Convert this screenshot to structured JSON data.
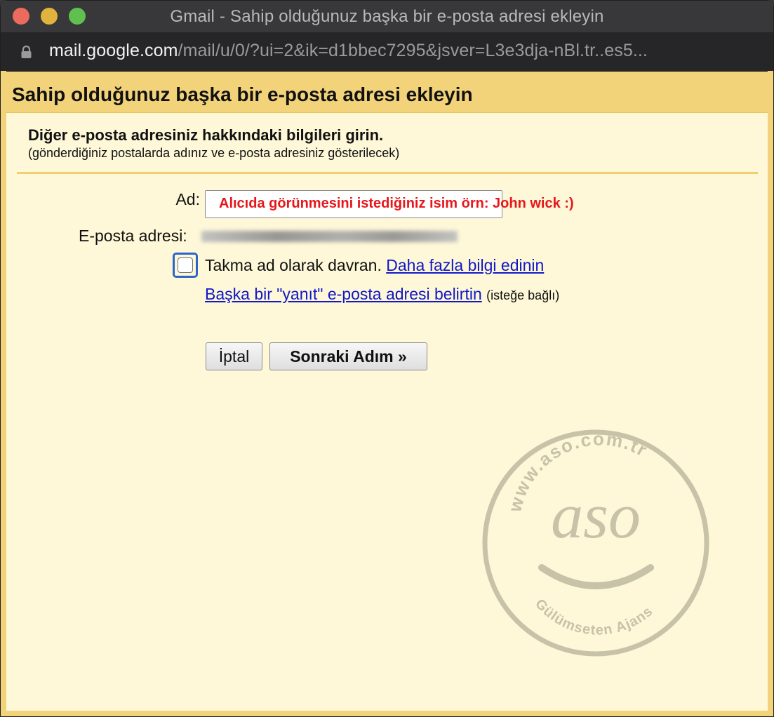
{
  "window": {
    "title": "Gmail - Sahip olduğunuz başka bir e-posta adresi ekleyin",
    "url_host": "mail.google.com",
    "url_path": "/mail/u/0/?ui=2&ik=d1bbec7295&jsver=L3e3dja-nBl.tr..es5..."
  },
  "dialog": {
    "heading": "Sahip olduğunuz başka bir e-posta adresi ekleyin",
    "intro_title": "Diğer e-posta adresiniz hakkındaki bilgileri girin.",
    "intro_subtitle": "(gönderdiğiniz postalarda adınız ve e-posta adresiniz gösterilecek)"
  },
  "form": {
    "name_label": "Ad:",
    "name_value": "",
    "name_annotation": "Alıcıda görünmesini istediğiniz isim örn: John wick :)",
    "email_label": "E-posta adresi:",
    "alias_checkbox_label": "Takma ad olarak davran.",
    "alias_checked": false,
    "learn_more_link": "Daha fazla bilgi edinin",
    "reply_to_link": "Başka bir \"yanıt\" e-posta adresi belirtin",
    "reply_to_optional": "(isteğe bağlı)"
  },
  "buttons": {
    "cancel": "İptal",
    "next": "Sonraki Adım »"
  },
  "watermark": {
    "url": "www.aso.com.tr",
    "logo": "aso",
    "tagline": "Gülümseten Ajans",
    "color": "#c8c2a9"
  },
  "colors": {
    "header_bg": "#f3d37a",
    "content_bg": "#fef8d8",
    "link": "#1118c8",
    "annotation": "#e8161a",
    "focus_ring": "#2a66c9"
  }
}
